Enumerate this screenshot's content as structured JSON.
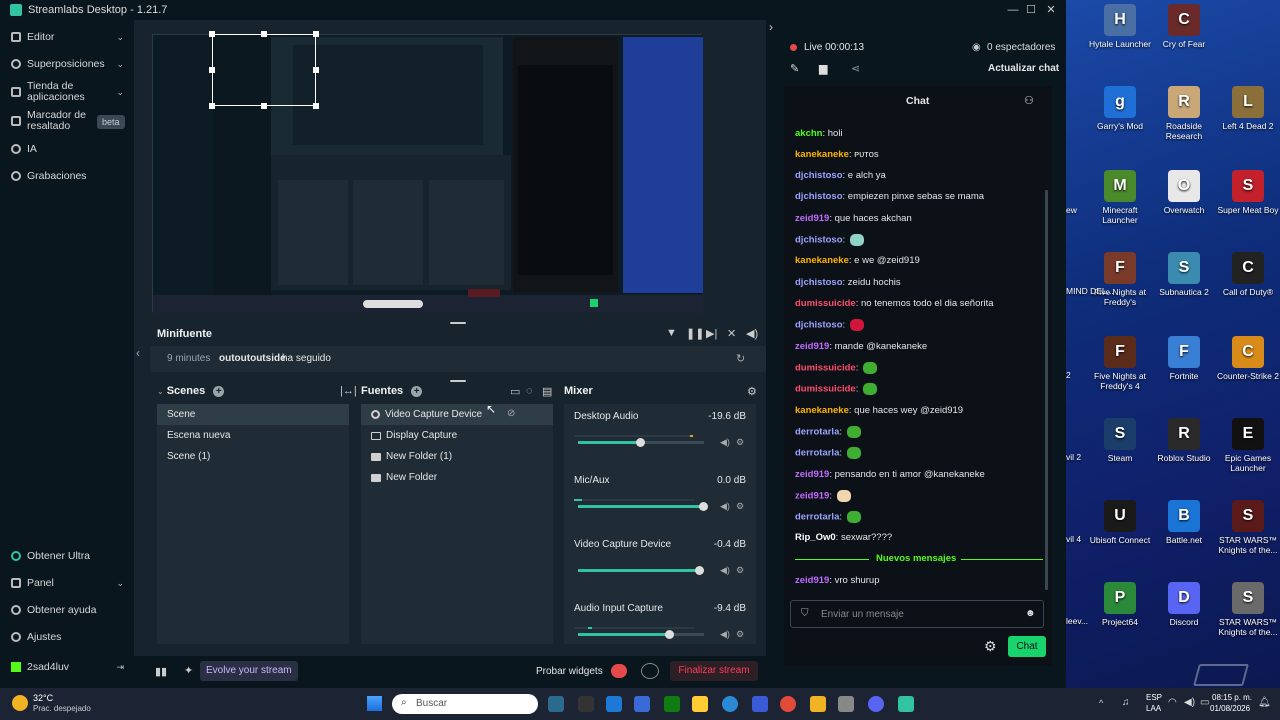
{
  "window": {
    "title": "Streamlabs Desktop - 1.21.7"
  },
  "leftnav": {
    "items": [
      {
        "label": "Editor",
        "chev": "⌄"
      },
      {
        "label": "Superposiciones",
        "chev": "⌄"
      },
      {
        "label": "Tienda de aplicaciones",
        "chev": "⌄"
      },
      {
        "label": "Marcador de resaltado",
        "badge": "beta"
      },
      {
        "label": "IA"
      },
      {
        "label": "Grabaciones"
      }
    ],
    "bottom": [
      {
        "label": "Obtener Ultra"
      },
      {
        "label": "Panel",
        "chev": "⌄"
      },
      {
        "label": "Obtener ayuda"
      },
      {
        "label": "Ajustes"
      }
    ],
    "user": "2sad4luv"
  },
  "minifeed": {
    "title": "Minifuente",
    "time": "9 minutes",
    "user": "outoutoutside",
    "action": "ha seguido"
  },
  "scenes": {
    "title": "Scenes",
    "items": [
      "Scene",
      "Escena nueva",
      "Scene (1)"
    ],
    "selected": 0
  },
  "sources": {
    "title": "Fuentes",
    "items": [
      "Video Capture Device",
      "Display Capture",
      "New Folder (1)",
      "New Folder"
    ]
  },
  "mixer": {
    "title": "Mixer",
    "tracks": [
      {
        "name": "Desktop Audio",
        "db": "-19.6 dB",
        "volume": 0.5
      },
      {
        "name": "Mic/Aux",
        "db": "0.0 dB",
        "volume": 1.0
      },
      {
        "name": "Video Capture Device",
        "db": "-0.4 dB",
        "volume": 0.97
      },
      {
        "name": "Audio Input Capture",
        "db": "-9.4 dB",
        "volume": 0.73
      }
    ]
  },
  "bottombar": {
    "evolve": "Evolve your stream",
    "test_widgets": "Probar widgets",
    "end_stream": "Finalizar stream"
  },
  "stream": {
    "live": "Live 00:00:13",
    "viewers": "0 espectadores",
    "refresh_chat": "Actualizar chat"
  },
  "chat": {
    "title": "Chat",
    "messages": [
      {
        "user": "akchn",
        "text": "holi",
        "color": "#53fc18"
      },
      {
        "user": "kanekaneke",
        "text": "ᴘᴜᴛᴏs",
        "color": "#ffb300"
      },
      {
        "user": "djchistoso",
        "text": "e alch ya",
        "color": "#9ba3ff"
      },
      {
        "user": "djchistoso",
        "text": "empiezen pinxe sebas se mama",
        "color": "#9ba3ff"
      },
      {
        "user": "zeid919",
        "text": "que haces akchan",
        "color": "#c26bff"
      },
      {
        "user": "djchistoso",
        "text": "",
        "color": "#9ba3ff",
        "emote": "#8fd3c9"
      },
      {
        "user": "kanekaneke",
        "text": "e we @zeid919",
        "color": "#ffb300"
      },
      {
        "user": "djchistoso",
        "text": "zeidu hochis",
        "color": "#9ba3ff"
      },
      {
        "user": "dumissuicide",
        "text": "no tenemos todo el dia señorita",
        "color": "#ff4d6d"
      },
      {
        "user": "djchistoso",
        "text": "",
        "color": "#9ba3ff",
        "emote": "#d0163b"
      },
      {
        "user": "zeid919",
        "text": "mande @kanekaneke",
        "color": "#c26bff"
      },
      {
        "user": "dumissuicide",
        "text": "",
        "color": "#ff4d6d",
        "emote": "#3fae33"
      },
      {
        "user": "dumissuicide",
        "text": "",
        "color": "#ff4d6d",
        "emote": "#3fae33"
      },
      {
        "user": "kanekaneke",
        "text": "que haces wey @zeid919",
        "color": "#ffb300"
      },
      {
        "user": "derrotarla",
        "text": "",
        "color": "#9ba3ff",
        "emote": "#3fae33"
      },
      {
        "user": "derrotarla",
        "text": "",
        "color": "#9ba3ff",
        "emote": "#3fae33"
      },
      {
        "user": "zeid919",
        "text": "pensando en ti amor @kanekaneke",
        "color": "#c26bff"
      },
      {
        "user": "zeid919",
        "text": "",
        "color": "#c26bff",
        "emote": "#f1d7b0"
      },
      {
        "user": "derrotarla",
        "text": "",
        "color": "#9ba3ff",
        "emote": "#3fae33"
      },
      {
        "user": "Rip_Ow0",
        "text": "sexwar????",
        "color": "#ffffff"
      }
    ],
    "new_messages": "Nuevos mensajes",
    "after_new": [
      {
        "user": "zeid919",
        "text": "vro shurup",
        "color": "#c26bff"
      }
    ],
    "input_placeholder": "Enviar un mensaje",
    "send": "Chat"
  },
  "desktop": {
    "icons": [
      {
        "label": "Hytale Launcher",
        "color": "#4a6fa5",
        "glyph": "H"
      },
      {
        "label": "Cry of Fear",
        "color": "#6b2a2a",
        "glyph": "C"
      },
      {
        "label": "Garry's Mod",
        "color": "#1f6fd6",
        "glyph": "g"
      },
      {
        "label": "Roadside Research",
        "color": "#c9a777",
        "glyph": "R"
      },
      {
        "label": "Left 4 Dead 2",
        "color": "#8a6f3a",
        "glyph": "L"
      },
      {
        "label": "Minecraft Launcher",
        "color": "#4a8a2a",
        "glyph": "M"
      },
      {
        "label": "Overwatch",
        "color": "#e8e8e8",
        "glyph": "O"
      },
      {
        "label": "Super Meat Boy",
        "color": "#c2212b",
        "glyph": "S"
      },
      {
        "label": "Five Nights at Freddy's",
        "color": "#7a3a2a",
        "glyph": "F"
      },
      {
        "label": "Subnautica 2",
        "color": "#3b8bb0",
        "glyph": "S"
      },
      {
        "label": "Call of Duty®",
        "color": "#222222",
        "glyph": "C"
      },
      {
        "label": "Five Nights at Freddy's 4",
        "color": "#5a2a1a",
        "glyph": "F"
      },
      {
        "label": "Fortnite",
        "color": "#3a7fd6",
        "glyph": "F"
      },
      {
        "label": "Counter-Strike 2",
        "color": "#d98b1a",
        "glyph": "C"
      },
      {
        "label": "Steam",
        "color": "#1b3d6a",
        "glyph": "S"
      },
      {
        "label": "Roblox Studio",
        "color": "#2a2a2a",
        "glyph": "R"
      },
      {
        "label": "Epic Games Launcher",
        "color": "#111111",
        "glyph": "E"
      },
      {
        "label": "Ubisoft Connect",
        "color": "#1a1a1a",
        "glyph": "U"
      },
      {
        "label": "Battle.net",
        "color": "#1a74d6",
        "glyph": "B"
      },
      {
        "label": "STAR WARS™ Knights of the...",
        "color": "#5a1a1a",
        "glyph": "S"
      },
      {
        "label": "Project64",
        "color": "#2a8a3a",
        "glyph": "P"
      },
      {
        "label": "Discord",
        "color": "#5865f2",
        "glyph": "D"
      },
      {
        "label": "STAR WARS™ Knights of the...",
        "color": "#6a6a6a",
        "glyph": "S"
      }
    ],
    "partial": [
      "ew",
      "MIND DEL...",
      "2",
      "vil 2",
      "vil 4",
      "leev..."
    ]
  },
  "taskbar": {
    "weather": "32°C",
    "weather_desc": "Prac. despejado",
    "search": "Buscar",
    "lang": "ESP",
    "lang2": "LAA",
    "time": "08:15 p. m.",
    "date": "01/08/2026"
  }
}
